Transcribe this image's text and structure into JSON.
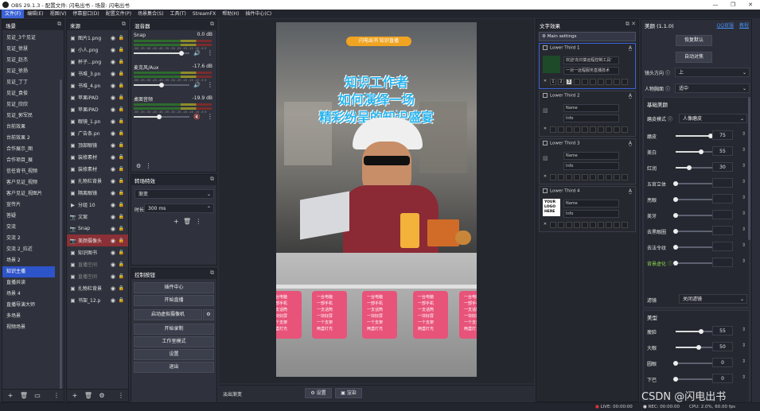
{
  "window": {
    "title": "OBS 29.1.3 - 配置文件: 闪电出书 - 场景: 闪电出书",
    "controls": [
      "—",
      "❐",
      "✕"
    ]
  },
  "menu": [
    "文件(F)",
    "编辑(E)",
    "视图(V)",
    "停靠窗口(D)",
    "配置文件(P)",
    "场景集合(S)",
    "工具(T)",
    "StreamFX",
    "帮助(H)",
    "插件中心(C)"
  ],
  "scenes": {
    "title": "场景",
    "items": [
      "见证_3个见证",
      "见证_徐慧",
      "见证_赵杰",
      "见证_徐扬",
      "见证_丁丁",
      "见证_袁俊",
      "见证_欣欣",
      "见证_郭军民",
      "台前效果",
      "台前效果 2",
      "合作展示_图",
      "合作项目_展",
      "信任背书_视频",
      "客户见证_视频",
      "客户见证_视图片",
      "宣传片",
      "答疑",
      "交流",
      "交流 2",
      "交流 2_拉近",
      "场景 2",
      "知识主播",
      "直播共读",
      "场景 4",
      "直播导演大师",
      "多场景",
      "视频场景"
    ],
    "selected": "知识主播"
  },
  "sources": {
    "title": "来源",
    "items": [
      {
        "icon": "image-icon",
        "name": "图片1.png"
      },
      {
        "icon": "image-icon",
        "name": "小人.png"
      },
      {
        "icon": "image-icon",
        "name": "杯子...png"
      },
      {
        "icon": "image-icon",
        "name": "书堆_3.pn"
      },
      {
        "icon": "image-icon",
        "name": "书堆_4.pn"
      },
      {
        "icon": "image-icon",
        "name": "苹果iPAD"
      },
      {
        "icon": "image-icon",
        "name": "苹果iPAD"
      },
      {
        "icon": "image-icon",
        "name": "眼镜_1.pn"
      },
      {
        "icon": "image-icon",
        "name": "广告条.pn"
      },
      {
        "icon": "image-icon",
        "name": "顶部眼镜"
      },
      {
        "icon": "image-icon",
        "name": "装修素材"
      },
      {
        "icon": "image-icon",
        "name": "装修素材"
      },
      {
        "icon": "image-icon",
        "name": "扎物栏背景"
      },
      {
        "icon": "image-icon",
        "name": "隔离眼镜"
      },
      {
        "icon": "folder-icon",
        "name": "分组 10"
      },
      {
        "icon": "camera-icon",
        "name": "文案"
      },
      {
        "icon": "camera-icon",
        "name": "Snap"
      },
      {
        "icon": "camera-icon",
        "name": "美颜摄像头"
      },
      {
        "icon": "image-icon",
        "name": "知识图书"
      },
      {
        "icon": "image-icon",
        "name": "直播空间"
      },
      {
        "icon": "image-icon",
        "name": "直播空间"
      },
      {
        "icon": "image-icon",
        "name": "扎物栏背景"
      },
      {
        "icon": "image-icon",
        "name": "书架_12.p"
      }
    ]
  },
  "mixer": {
    "title": "混音器",
    "channels": [
      {
        "name": "Snap",
        "db": "0.0 dB",
        "level": 0.85,
        "muted": false
      },
      {
        "name": "麦克风/Aux",
        "db": "-17.6 dB",
        "level": 0.5,
        "muted": false
      },
      {
        "name": "桌面音频",
        "db": "-19.9 dB",
        "level": 0.45,
        "muted": true
      }
    ],
    "scale": "-60 -55 -50 -45 -40 -35 -30 -25 -20 -15 -10 -5 0"
  },
  "transitions": {
    "title": "转场特效",
    "type": "渐变",
    "duration_label": "时长",
    "duration": "300 ms"
  },
  "controls": {
    "title": "控制按钮",
    "buttons": [
      "插件中心",
      "开始直播",
      "启动虚拟摄像机",
      "开始录制",
      "工作室模式",
      "设置",
      "退出"
    ]
  },
  "preview_overlay": {
    "badge": "闪电出书 知识直播",
    "line1": "知识工作者",
    "line2": "如何演绎一场",
    "line3": "精彩纷呈的知识盛宴",
    "card_lines": [
      "一台电脑",
      "一部手机",
      "一支话筒",
      "一块好屏",
      "一个支架",
      "两盏灯光"
    ]
  },
  "text_effect": {
    "title": "文字效果",
    "main_settings": "Main settings",
    "panels": [
      {
        "title": "Lower Third 1",
        "name": "欢迎'向日葵远程控制工具'",
        "info": "一对一远程服务直播技术",
        "buttons": [
          "1",
          "2",
          "3"
        ]
      },
      {
        "title": "Lower Third 2",
        "name": "Name",
        "info": "Info"
      },
      {
        "title": "Lower Third 3",
        "name": "Name",
        "info": "Info"
      },
      {
        "title": "Lower Third 4",
        "name": "Name",
        "info": "Info",
        "logo": "YOUR LOGO HERE"
      }
    ]
  },
  "beauty": {
    "title": "美颜 (1.1.0)",
    "links": [
      "QQ官服",
      "教程"
    ],
    "buttons": [
      "恢复默认",
      "自动对焦"
    ],
    "lens_label": "镜头方向",
    "lens_value": "上",
    "face_label": "人物胸面",
    "face_value": "适中",
    "basic_section": "基础美颜",
    "smooth_mode_label": "磨皮模式",
    "smooth_mode_value": "人像磨皮",
    "rows": [
      {
        "label": "磨皮",
        "value": "75",
        "level": 0.75
      },
      {
        "label": "美白",
        "value": "55",
        "level": 0.55
      },
      {
        "label": "红润",
        "value": "30",
        "level": 0.3
      },
      {
        "label": "五官立体",
        "value": "",
        "level": 0.0
      },
      {
        "label": "亮眼",
        "value": "",
        "level": 0.0
      },
      {
        "label": "美牙",
        "value": "",
        "level": 0.0
      },
      {
        "label": "去黑眼圈",
        "value": "",
        "level": 0.0
      },
      {
        "label": "去法令纹",
        "value": "",
        "level": 0.0
      },
      {
        "label": "背景虚化",
        "value": "",
        "level": 0.0
      }
    ],
    "filter_label": "滤镜",
    "filter_value": "关闭滤镜",
    "shape_section": "美型",
    "shape_rows": [
      {
        "label": "瘦脸",
        "value": "55",
        "level": 0.55
      },
      {
        "label": "大眼",
        "value": "50",
        "level": 0.5
      },
      {
        "label": "圆眼",
        "value": "0",
        "level": 0.0
      },
      {
        "label": "下巴",
        "value": "0",
        "level": 0.0
      }
    ]
  },
  "statusbar": {
    "transition_name": "淡出渐变",
    "btn_settings": "设置",
    "btn_source": "渲染",
    "live": "LIVE: 00:00:00",
    "rec": "REC: 00:00:00",
    "cpu": "CPU: 2.0%, 60.00 fps"
  },
  "watermark": "CSDN @闪电出书",
  "colors": {
    "accent": "#2e54c9",
    "selected_source": "#8a3036",
    "card": "#e8537a",
    "preview_text": "#23b5e8"
  }
}
